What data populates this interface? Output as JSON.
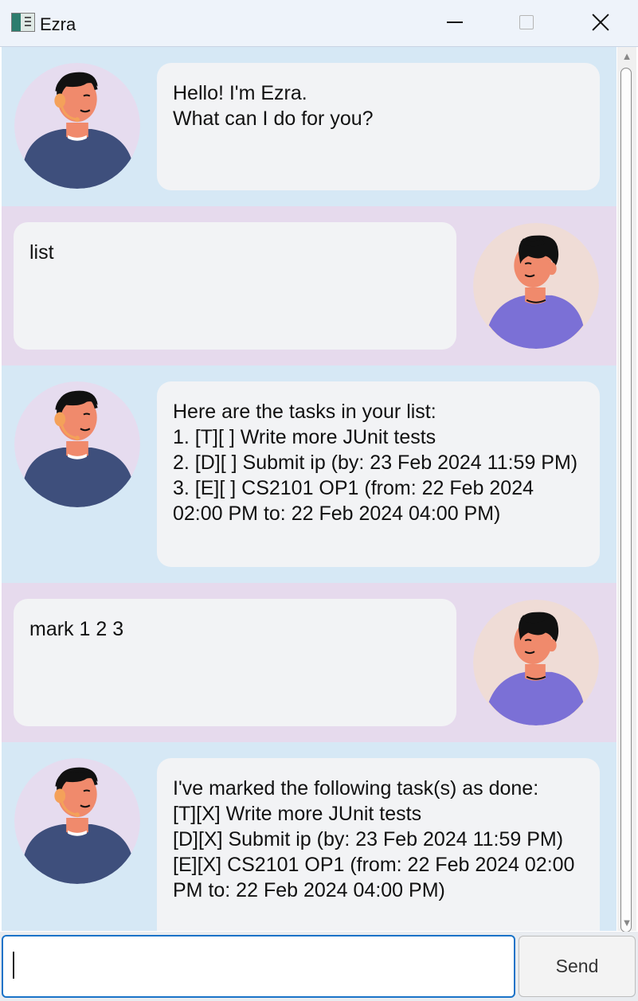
{
  "window": {
    "title": "Ezra"
  },
  "messages": [
    {
      "sender": "ezra",
      "text": "Hello! I'm Ezra.\nWhat can I do for you?"
    },
    {
      "sender": "user",
      "text": "list"
    },
    {
      "sender": "ezra",
      "text": "Here are the tasks in your list:\n1. [T][ ] Write more JUnit tests\n2. [D][ ] Submit ip (by: 23 Feb 2024 11:59 PM)\n3. [E][ ] CS2101 OP1 (from: 22 Feb 2024 02:00 PM to: 22 Feb 2024 04:00 PM)"
    },
    {
      "sender": "user",
      "text": "mark 1 2 3"
    },
    {
      "sender": "ezra",
      "text": "I've marked the following task(s) as done:\n[T][X] Write more JUnit tests\n[D][X] Submit ip (by: 23 Feb 2024 11:59 PM)\n[E][X] CS2101 OP1 (from: 22 Feb 2024 02:00 PM to: 22 Feb 2024 04:00 PM)"
    }
  ],
  "input": {
    "value": "",
    "placeholder": ""
  },
  "send_label": "Send",
  "colors": {
    "ezra_row": "#d6e8f5",
    "user_row": "#e6daed",
    "bubble": "#f2f3f5",
    "input_border": "#1a73c8"
  }
}
